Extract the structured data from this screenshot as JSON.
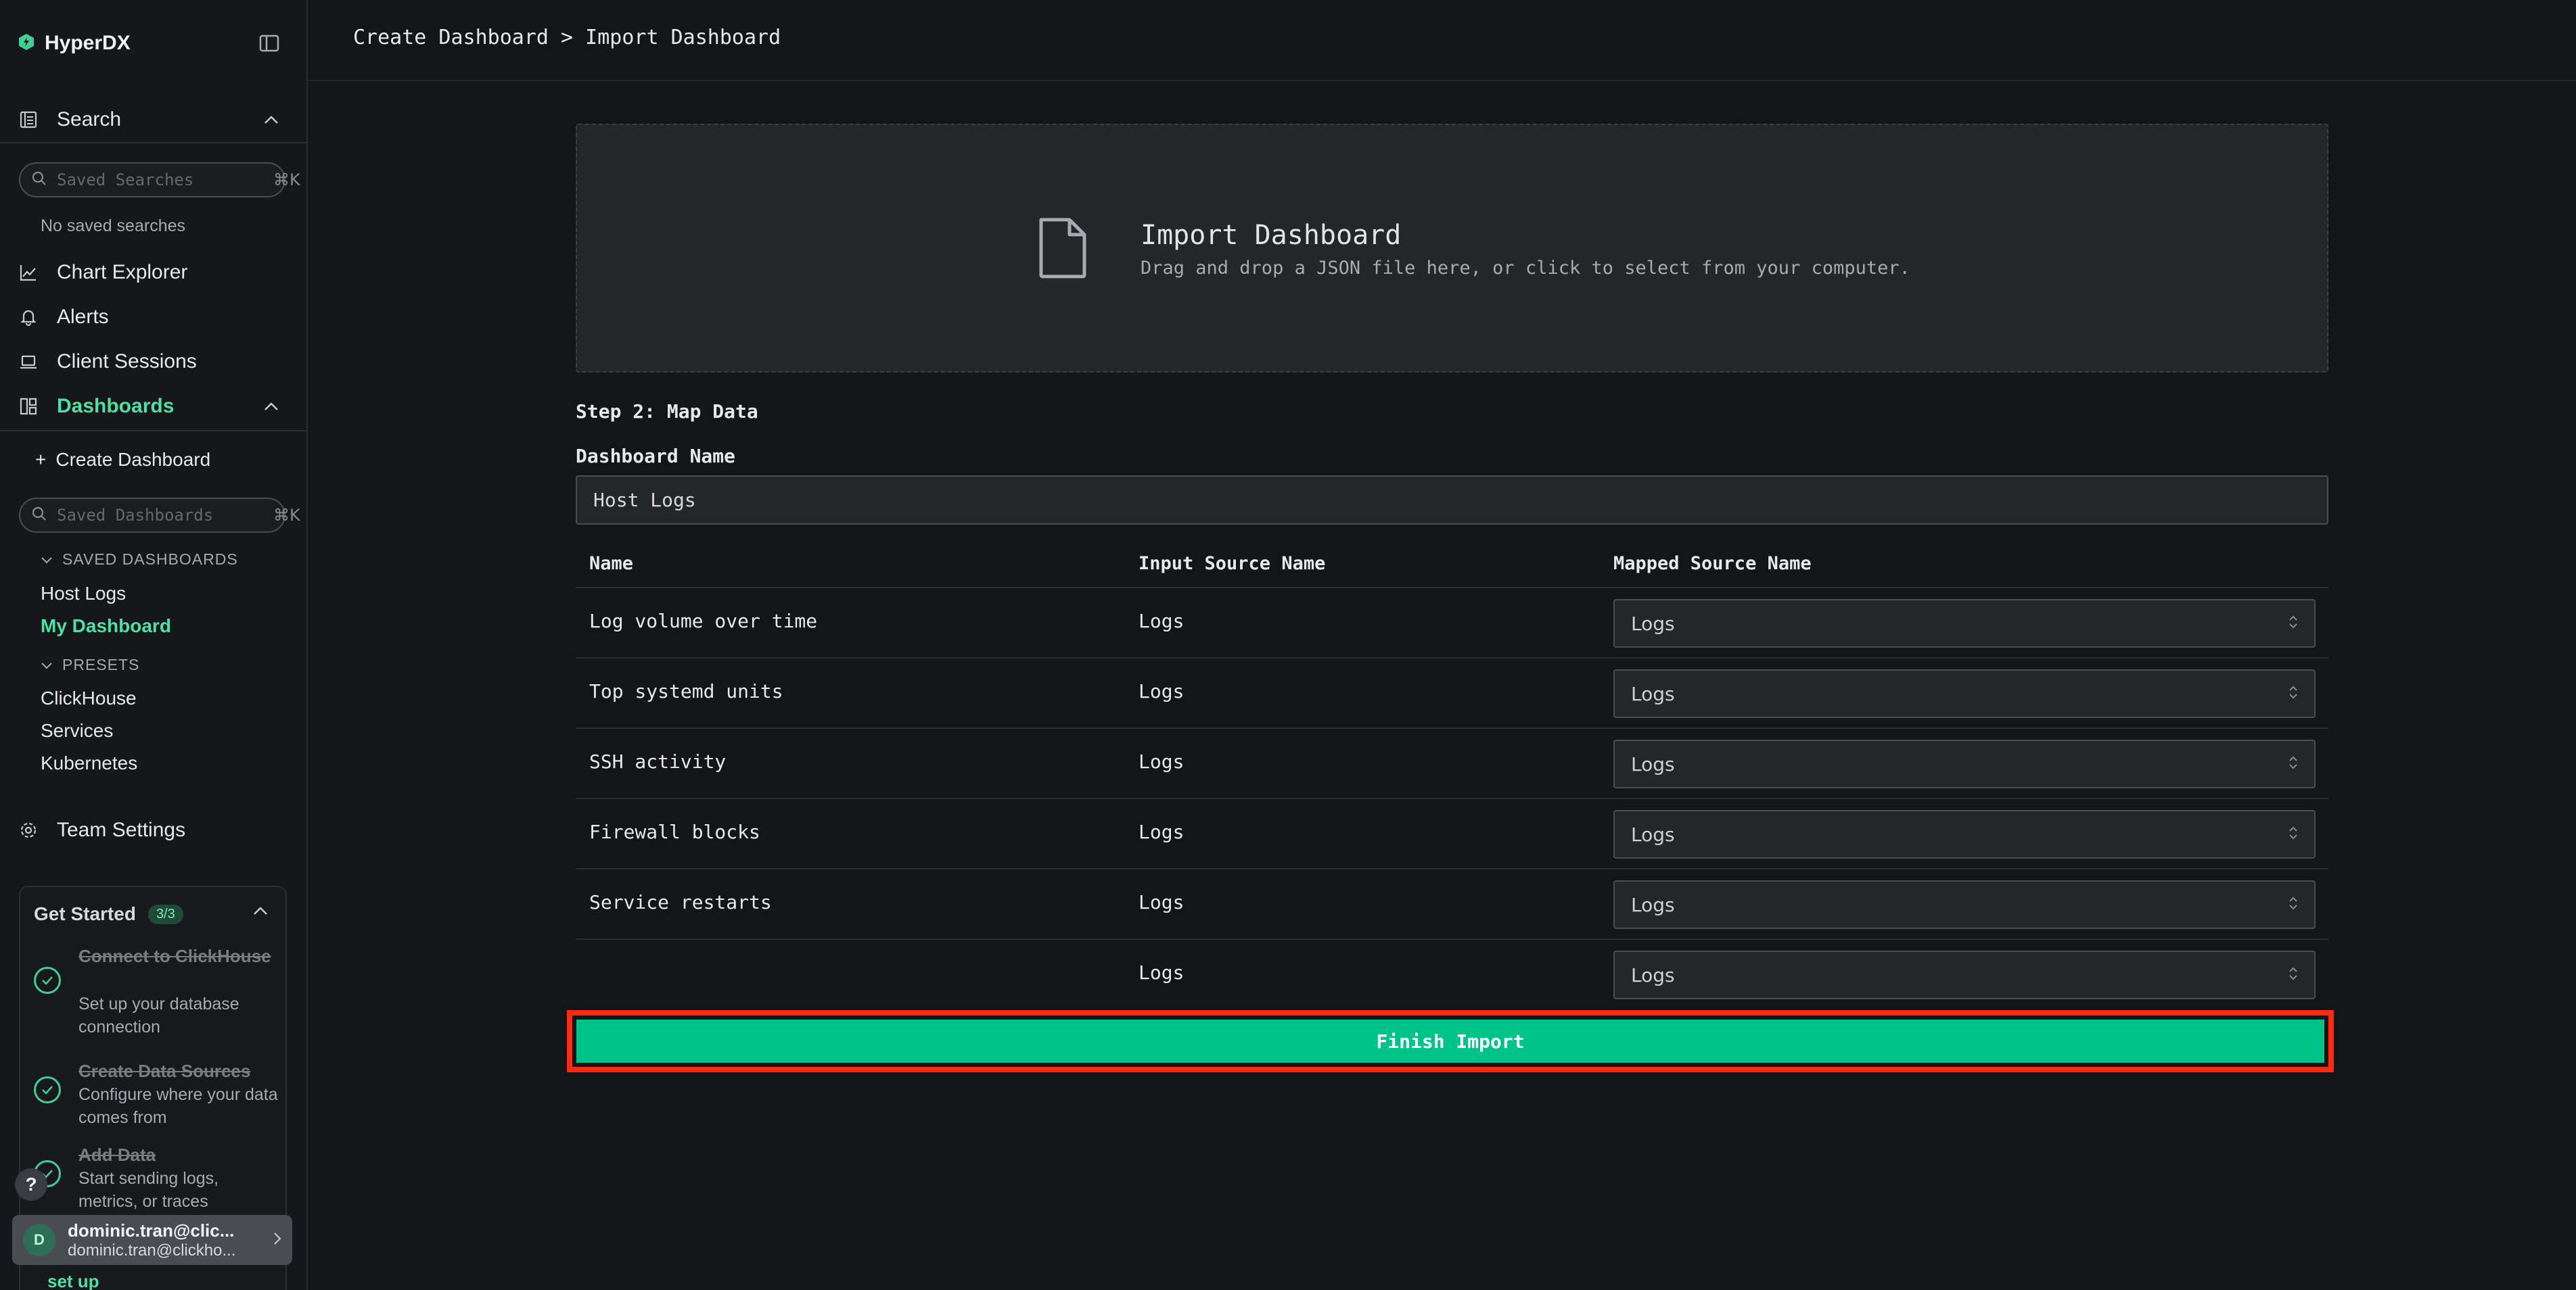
{
  "app": {
    "name": "HyperDX"
  },
  "sidebar": {
    "search": {
      "label": "Search",
      "placeholder": "Saved Searches",
      "shortcut": "⌘K",
      "empty_text": "No saved searches"
    },
    "nav": [
      {
        "label": "Chart Explorer",
        "icon": "chart-line-icon"
      },
      {
        "label": "Alerts",
        "icon": "bell-icon"
      },
      {
        "label": "Client Sessions",
        "icon": "laptop-icon"
      }
    ],
    "dashboards": {
      "label": "Dashboards",
      "create_label": "Create Dashboard",
      "placeholder": "Saved Dashboards",
      "shortcut": "⌘K",
      "saved_header": "SAVED DASHBOARDS",
      "saved": [
        "Host Logs",
        "My Dashboard"
      ],
      "presets_header": "PRESETS",
      "presets": [
        "ClickHouse",
        "Services",
        "Kubernetes"
      ]
    },
    "team_settings": "Team Settings",
    "get_started": {
      "title": "Get Started",
      "progress": "3/3",
      "steps": [
        {
          "title": "Connect to ClickHouse",
          "desc": "Set up your database connection"
        },
        {
          "title": "Create Data Sources",
          "desc": "Configure where your data comes from"
        },
        {
          "title": "Add Data",
          "desc": "Start sending logs, metrics, or traces"
        }
      ],
      "setup_link": "set up"
    },
    "help": "?",
    "user": {
      "initial": "D",
      "name": "dominic.tran@clic...",
      "email": "dominic.tran@clickho..."
    }
  },
  "header": {
    "breadcrumb": "Create Dashboard > Import Dashboard"
  },
  "import": {
    "title": "Import Dashboard",
    "subtitle": "Drag and drop a JSON file here, or click to select from your computer."
  },
  "mapping": {
    "step_title": "Step 2: Map Data",
    "name_label": "Dashboard Name",
    "name_value": "Host Logs",
    "columns": [
      "Name",
      "Input Source Name",
      "Mapped Source Name"
    ],
    "rows": [
      {
        "name": "Log volume over time",
        "input": "Logs",
        "mapped": "Logs"
      },
      {
        "name": "Top systemd units",
        "input": "Logs",
        "mapped": "Logs"
      },
      {
        "name": "SSH activity",
        "input": "Logs",
        "mapped": "Logs"
      },
      {
        "name": "Firewall blocks",
        "input": "Logs",
        "mapped": "Logs"
      },
      {
        "name": "Service restarts",
        "input": "Logs",
        "mapped": "Logs"
      },
      {
        "name": "",
        "input": "Logs",
        "mapped": "Logs"
      }
    ],
    "finish_label": "Finish Import"
  },
  "colors": {
    "accent": "#4fe0a6",
    "primary_button": "#00c38a",
    "highlight": "#ff2a10"
  }
}
